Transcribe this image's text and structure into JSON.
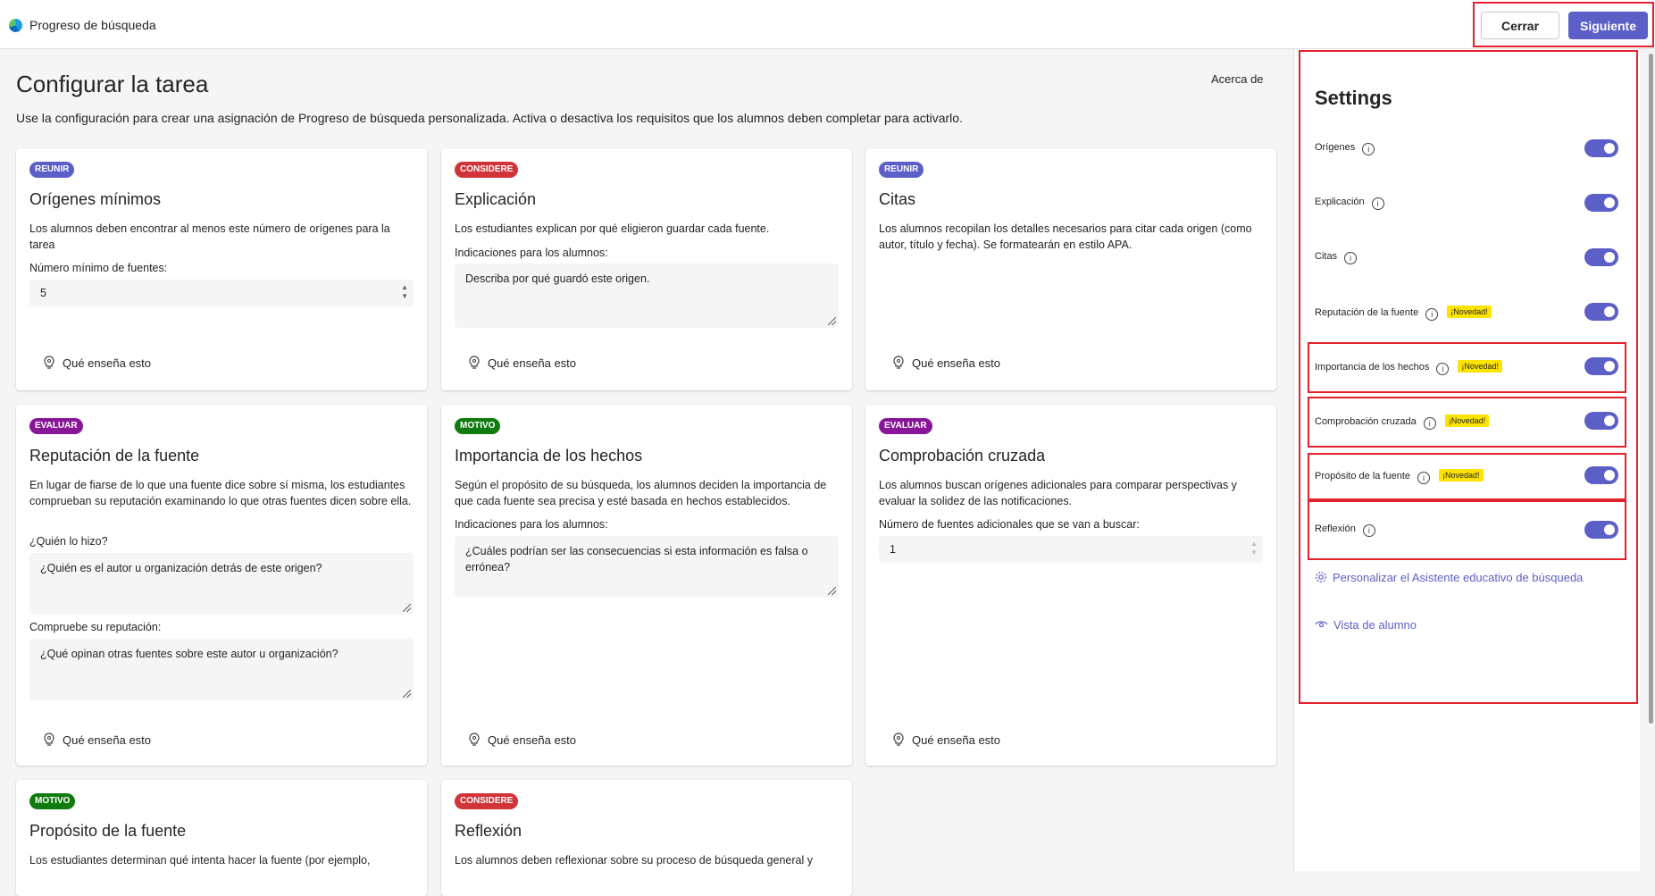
{
  "header": {
    "app_title": "Progreso de búsqueda",
    "close_label": "Cerrar",
    "next_label": "Siguiente"
  },
  "main": {
    "title": "Configurar la tarea",
    "about_label": "Acerca de",
    "description": "Use la configuración para crear una asignación de Progreso de búsqueda personalizada. Activa o desactiva los requisitos que los alumnos deben completar para activarlo.",
    "teach_label": "Qué enseña esto",
    "cards": [
      {
        "badge": "REUNIR",
        "badge_color": "#5b5fc7",
        "title": "Orígenes mínimos",
        "description": "Los alumnos deben encontrar al menos este número de orígenes para la tarea",
        "field_label": "Número mínimo de fuentes:",
        "field_value": "5"
      },
      {
        "badge": "CONSIDERE",
        "badge_color": "#d13438",
        "title": "Explicación",
        "description": "Los estudiantes explican por qué eligieron guardar cada fuente.",
        "field_label": "Indicaciones para los alumnos:",
        "field_value": "Describa por qué guardó este origen."
      },
      {
        "badge": "REUNIR",
        "badge_color": "#5b5fc7",
        "title": "Citas",
        "description": "Los alumnos recopilan los detalles necesarios para citar cada origen (como autor, título y fecha). Se formatearán en estilo APA."
      },
      {
        "badge": "EVALUAR",
        "badge_color": "#881798",
        "title": "Reputación de la fuente",
        "description": "En lugar de fiarse de lo que una fuente dice sobre sí misma, los estudiantes comprueban su reputación examinando lo que otras fuentes dicen sobre ella.",
        "field_label": "¿Quién lo hizo?",
        "field_value": "¿Quién es el autor u organización detrás de este origen?",
        "field2_label": "Compruebe su reputación:",
        "field2_value": "¿Qué opinan otras fuentes sobre este autor u organización?"
      },
      {
        "badge": "MOTIVO",
        "badge_color": "#107c10",
        "title": "Importancia de los hechos",
        "description": "Según el propósito de su búsqueda, los alumnos deciden la importancia de que cada fuente sea precisa y esté basada en hechos establecidos.",
        "field_label": "Indicaciones para los alumnos:",
        "field_value": "¿Cuáles podrían ser las consecuencias si esta información es falsa o errónea?"
      },
      {
        "badge": "EVALUAR",
        "badge_color": "#881798",
        "title": "Comprobación cruzada",
        "description": "Los alumnos buscan orígenes adicionales para comparar perspectivas y evaluar la solidez de las notificaciones.",
        "field_label": "Número de fuentes adicionales que se van a buscar:",
        "field_value": "1"
      },
      {
        "badge": "MOTIVO",
        "badge_color": "#107c10",
        "title": "Propósito de la fuente",
        "description": "Los estudiantes determinan qué intenta hacer la fuente (por ejemplo,"
      },
      {
        "badge": "CONSIDERE",
        "badge_color": "#d13438",
        "title": "Reflexión",
        "description": "Los alumnos deben reflexionar sobre su proceso de búsqueda general y"
      }
    ]
  },
  "settings": {
    "title": "Settings",
    "new_badge": "¡Novedad!",
    "info_glyph": "i",
    "toggle_color": "#5b5fc7",
    "items": [
      {
        "label": "Orígenes",
        "new": false,
        "on": true
      },
      {
        "label": "Explicación",
        "new": false,
        "on": true
      },
      {
        "label": "Citas",
        "new": false,
        "on": true
      },
      {
        "label": "Reputación de la fuente",
        "new": true,
        "on": true
      },
      {
        "label": "Importancia de los hechos",
        "new": true,
        "on": true
      },
      {
        "label": "Comprobación cruzada",
        "new": true,
        "on": true
      },
      {
        "label": "Propósito de la fuente",
        "new": true,
        "on": true
      },
      {
        "label": "Reflexión",
        "new": false,
        "on": true
      }
    ],
    "customize_label": "Personalizar el Asistente educativo de búsqueda",
    "student_view_label": "Vista de alumno"
  }
}
